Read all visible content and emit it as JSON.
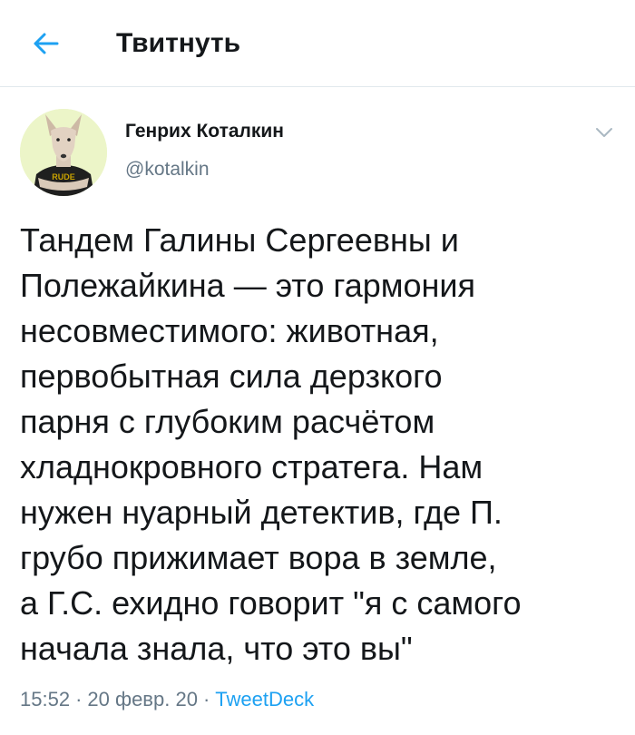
{
  "header": {
    "back_icon": "arrow-left-icon",
    "title": "Твитнуть"
  },
  "author": {
    "avatar_icon": "dog-avatar-icon",
    "avatar_text": "RUDE",
    "name": "Генрих Коталкин",
    "handle": "@kotalkin",
    "menu_icon": "chevron-down-icon"
  },
  "tweet": {
    "text": "Тандем Галины Сергеевны и\nПолежайкина — это гармония\nнесовместимого: животная,\nпервобытная сила дерзкого\nпарня с глубоким расчётом\nхладнокровного стратега. Нам\nнужен нуарный детектив, где П.\nгрубо прижимает вора в земле,\nа Г.С. ехидно говорит \"я с самого\nначала знала, что это вы\""
  },
  "meta": {
    "time": "15:52",
    "separator": "·",
    "date": "20 февр. 20",
    "source": "TweetDeck"
  },
  "colors": {
    "accent": "#1da1f2",
    "text": "#14171a",
    "secondary": "#657786",
    "divider": "#e1e8ed",
    "avatar_bg": "#ecf5c8"
  }
}
